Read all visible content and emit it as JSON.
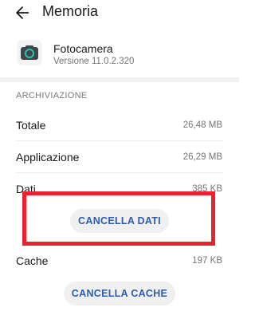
{
  "header": {
    "title": "Memoria",
    "back_icon": "arrow-left-icon"
  },
  "app": {
    "name": "Fotocamera",
    "version": "Versione 11.0.2.320",
    "icon": "camera-icon"
  },
  "storage": {
    "section_title": "ARCHIVIAZIONE",
    "rows": [
      {
        "label": "Totale",
        "value": "26,48 MB"
      },
      {
        "label": "Applicazione",
        "value": "26,29 MB"
      },
      {
        "label": "Dati",
        "value": "385 KB"
      }
    ],
    "clear_data_button": "CANCELLA DATI"
  },
  "cache": {
    "label": "Cache",
    "value": "197 KB",
    "clear_cache_button": "CANCELLA CACHE"
  },
  "colors": {
    "accent": "#2a5db0",
    "highlight_border": "#e8222f",
    "pill_bg": "#f0f0f0"
  }
}
